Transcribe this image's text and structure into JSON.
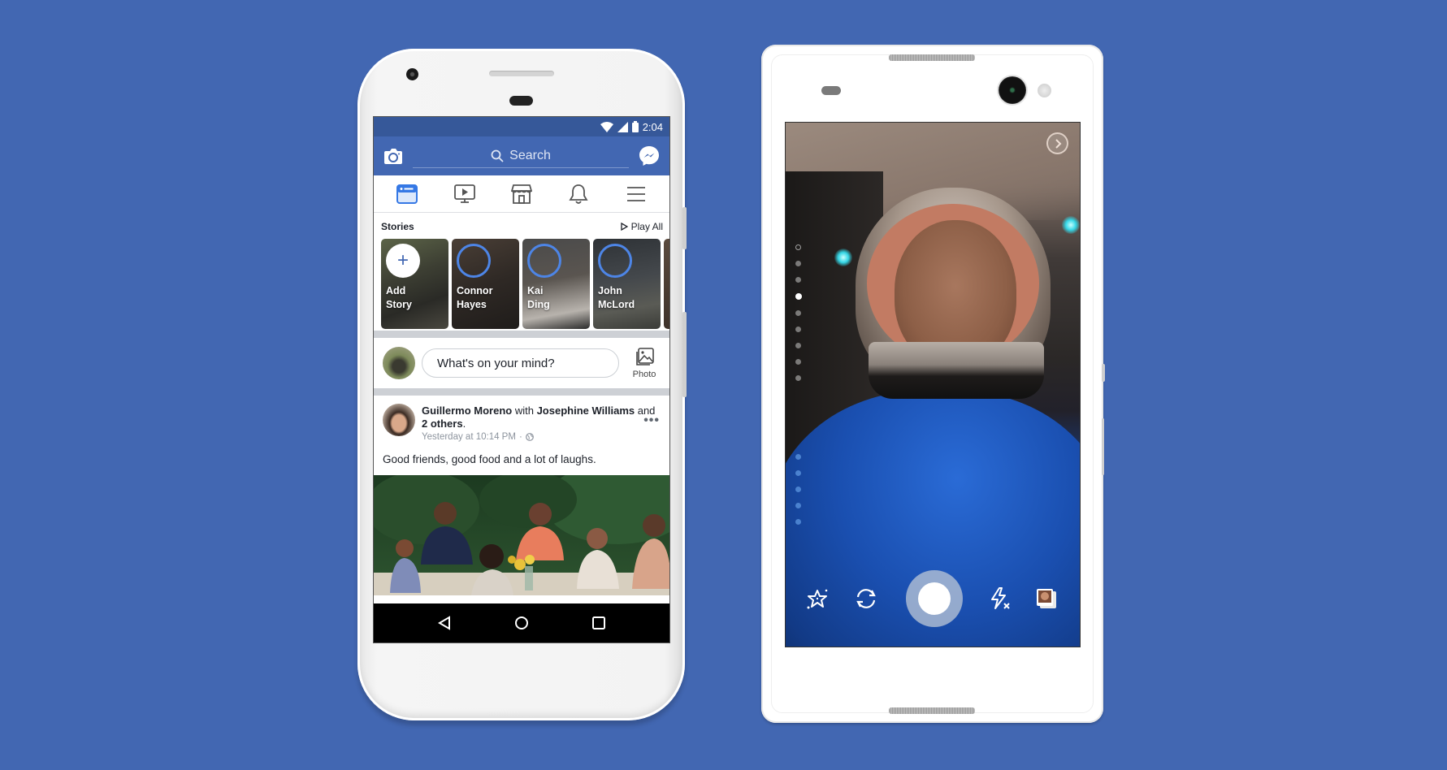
{
  "colors": {
    "background": "#4267B2",
    "fb_blue": "#4267B2",
    "status_bar": "#365899",
    "story_ring": "#4D85E6"
  },
  "left_phone": {
    "status_bar": {
      "time": "2:04",
      "icons": [
        "wifi-icon",
        "cell-signal-icon",
        "battery-icon"
      ]
    },
    "header": {
      "camera_icon": "camera-icon",
      "search_placeholder": "Search",
      "messenger_icon": "messenger-icon"
    },
    "nav_tabs": [
      {
        "name": "news-feed",
        "icon": "news-feed-icon",
        "active": true
      },
      {
        "name": "watch",
        "icon": "watch-video-icon",
        "active": false
      },
      {
        "name": "marketplace",
        "icon": "marketplace-store-icon",
        "active": false
      },
      {
        "name": "notifications",
        "icon": "bell-icon",
        "active": false
      },
      {
        "name": "menu",
        "icon": "hamburger-menu-icon",
        "active": false
      }
    ],
    "stories": {
      "title": "Stories",
      "play_all": "Play All",
      "cards": [
        {
          "line1": "Add",
          "line2": "Story",
          "type": "add"
        },
        {
          "line1": "Connor",
          "line2": "Hayes",
          "type": "friend"
        },
        {
          "line1": "Kai",
          "line2": "Ding",
          "type": "friend"
        },
        {
          "line1": "John",
          "line2": "McLord",
          "type": "friend"
        }
      ]
    },
    "composer": {
      "placeholder": "What's on your mind?",
      "photo_label": "Photo"
    },
    "post": {
      "author": "Guillermo Moreno",
      "with_word": " with ",
      "tagged": "Josephine Williams",
      "and_word": " and ",
      "others": "2 others",
      "period": ".",
      "timestamp": "Yesterday at 10:14 PM",
      "separator": "·",
      "privacy_icon": "globe-icon",
      "text": "Good friends, good food and a lot of laughs.",
      "more_label": "•••"
    },
    "android_nav": [
      "back-icon",
      "home-icon",
      "recents-icon"
    ]
  },
  "right_phone": {
    "camera_screen": {
      "next_icon": "chevron-right-icon",
      "controls": [
        "effects-sparkle-icon",
        "flip-camera-icon",
        "shutter-button",
        "flash-off-icon",
        "gallery-icon"
      ],
      "effect_dots_count": 14,
      "active_effect_index": 3
    }
  }
}
